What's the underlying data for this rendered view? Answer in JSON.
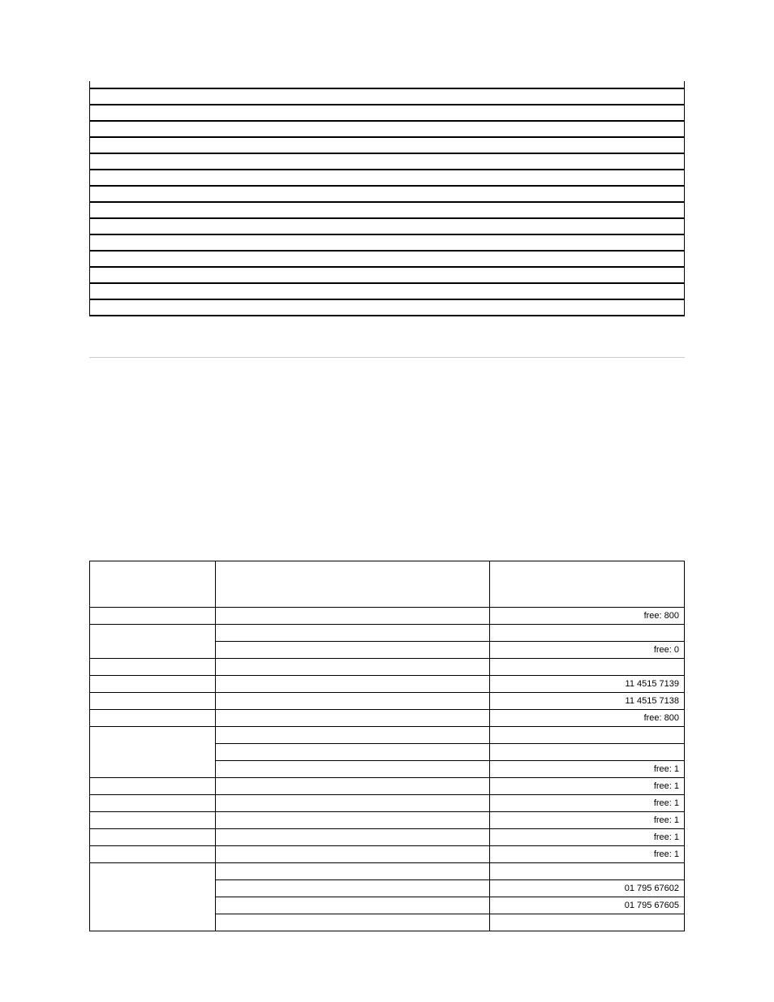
{
  "upper_block": {
    "initial_partial_rows": 1,
    "full_rows": 14
  },
  "lower_table": {
    "header": [
      "",
      "",
      ""
    ],
    "rows": [
      {
        "a_span": 1,
        "a": "",
        "b": "",
        "c": "free: 800"
      },
      {
        "a_span": 2,
        "a": "",
        "b": "",
        "c": ""
      },
      {
        "b": "",
        "c": "free: 0"
      },
      {
        "a_span": 1,
        "a": "",
        "b": "",
        "c": ""
      },
      {
        "a_span": 1,
        "a": "",
        "b": "",
        "c": "11 4515 7139"
      },
      {
        "a_span": 1,
        "a": "",
        "b": "",
        "c": "11 4515 7138"
      },
      {
        "a_span": 1,
        "a": "",
        "b": "",
        "c": "free: 800"
      },
      {
        "a_span": 3,
        "a": "",
        "b": "",
        "c": ""
      },
      {
        "b": "",
        "c": ""
      },
      {
        "b": "",
        "c": "free: 1"
      },
      {
        "a_span": 1,
        "a": "",
        "b": "",
        "c": "free: 1"
      },
      {
        "a_span": 1,
        "a": "",
        "b": "",
        "c": "free: 1"
      },
      {
        "a_span": 1,
        "a": "",
        "b": "",
        "c": "free: 1"
      },
      {
        "a_span": 1,
        "a": "",
        "b": "",
        "c": "free: 1"
      },
      {
        "a_span": 1,
        "a": "",
        "b": "",
        "c": "free: 1"
      },
      {
        "a_span": 4,
        "a": "",
        "b": "",
        "c": ""
      },
      {
        "b": "",
        "c": "01 795 67602"
      },
      {
        "b": "",
        "c": "01 795 67605"
      },
      {
        "b": "",
        "c": ""
      }
    ]
  }
}
